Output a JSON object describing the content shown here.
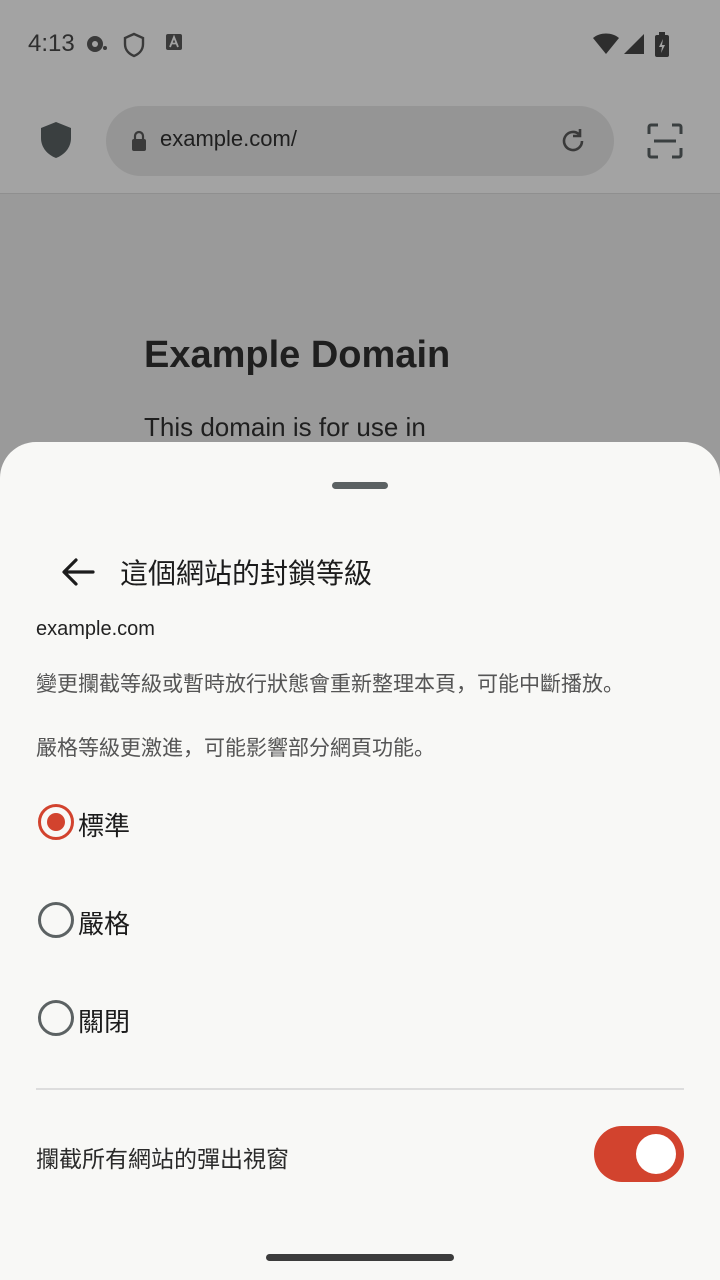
{
  "status_bar": {
    "time": "4:13"
  },
  "browser": {
    "url": "example.com/",
    "page_heading": "Example Domain",
    "page_paragraph": "This domain is for use in"
  },
  "sheet": {
    "title": "這個網站的封鎖等級",
    "domain": "example.com",
    "description_1": "變更攔截等級或暫時放行狀態會重新整理本頁，可能中斷播放。",
    "description_2": "嚴格等級更激進，可能影響部分網頁功能。",
    "options": [
      {
        "label": "標準",
        "selected": true
      },
      {
        "label": "嚴格",
        "selected": false
      },
      {
        "label": "關閉",
        "selected": false
      }
    ],
    "popup_block_label": "攔截所有網站的彈出視窗",
    "popup_block_enabled": true
  },
  "colors": {
    "accent": "#d2432e",
    "sheet_background": "#f8f8f6",
    "scrim": "#9a9a9a"
  }
}
